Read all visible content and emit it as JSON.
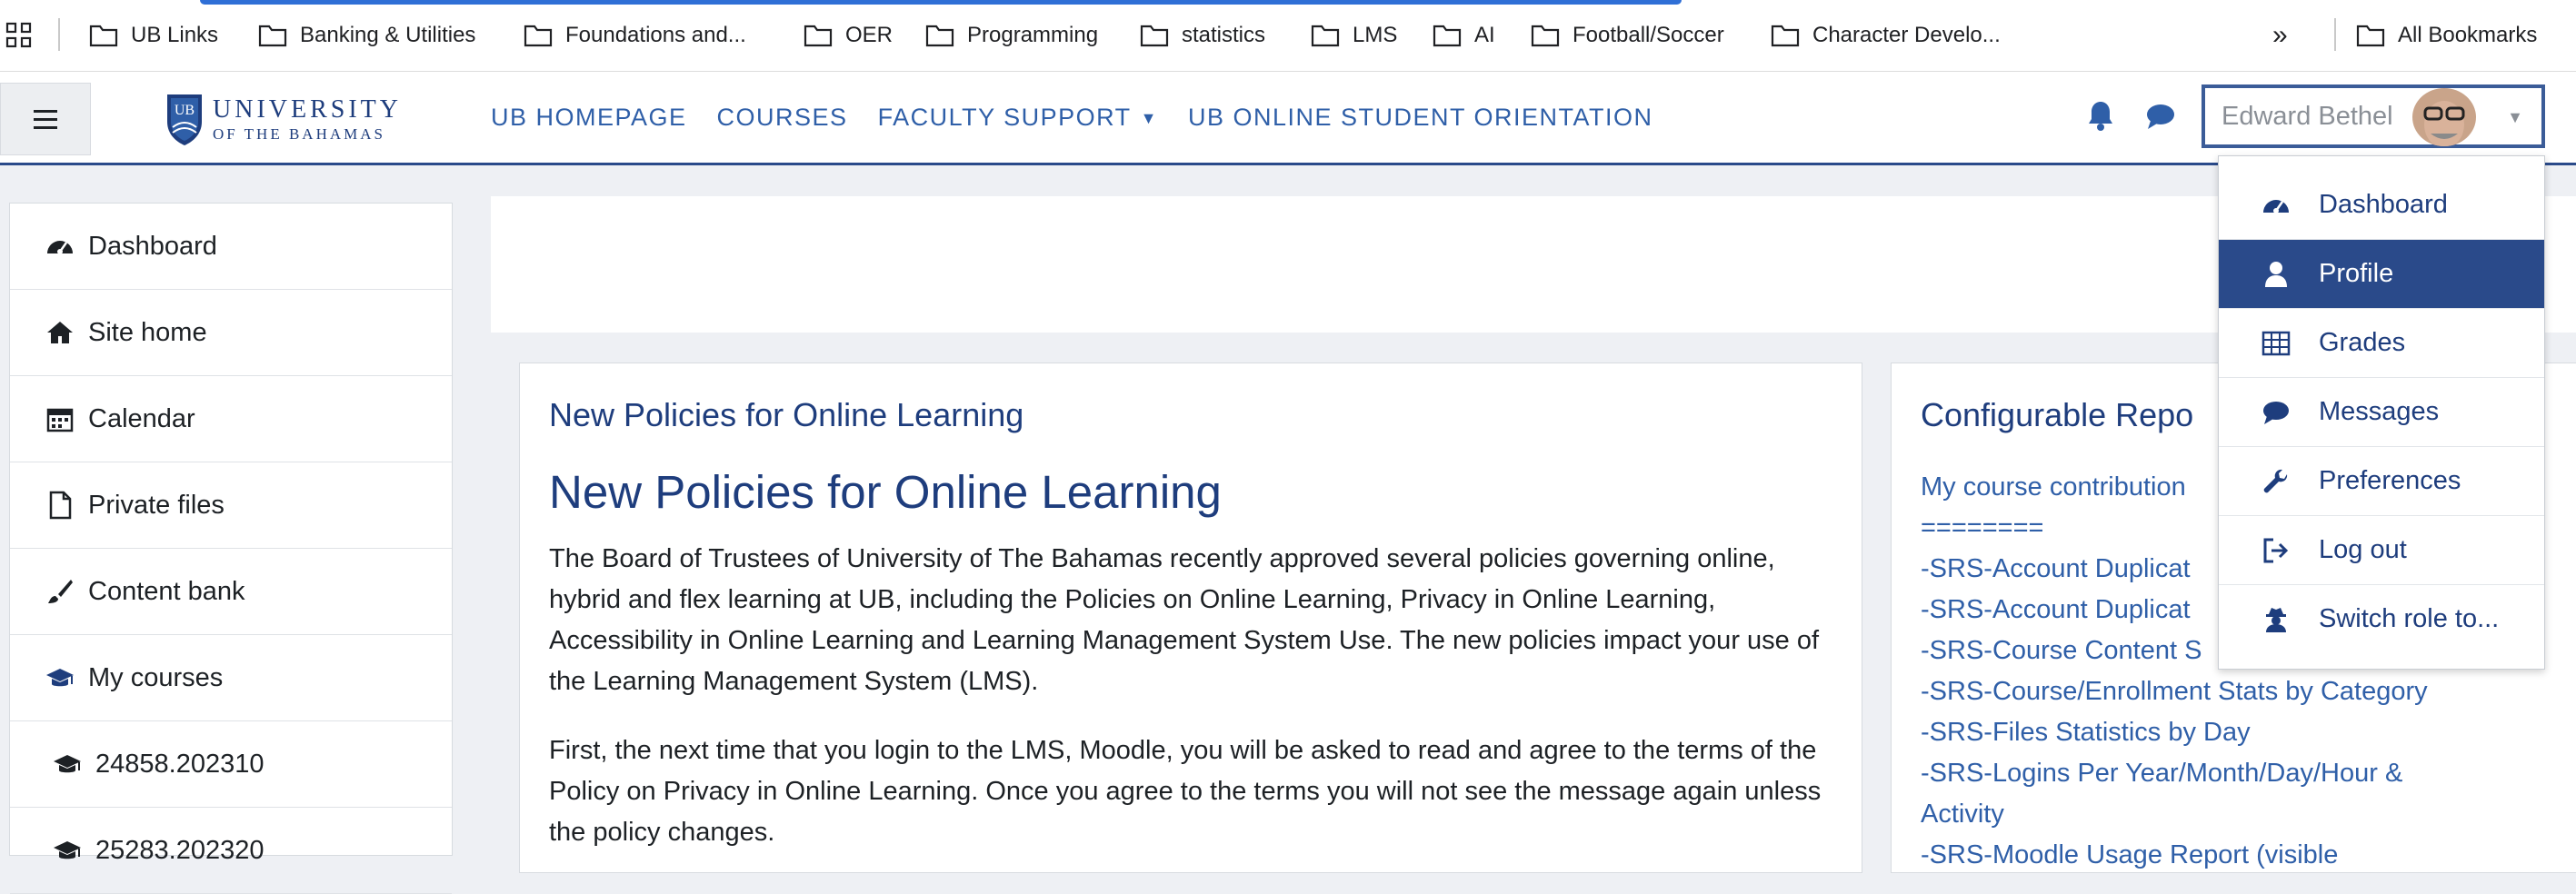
{
  "bookmarks": {
    "items": [
      {
        "label": "UB Links"
      },
      {
        "label": "Banking & Utilities"
      },
      {
        "label": "Foundations and..."
      },
      {
        "label": "OER"
      },
      {
        "label": "Programming"
      },
      {
        "label": "statistics"
      },
      {
        "label": "LMS"
      },
      {
        "label": "AI"
      },
      {
        "label": "Football/Soccer"
      },
      {
        "label": "Character Develo..."
      }
    ],
    "overflow_label": "»",
    "all_label": "All Bookmarks"
  },
  "header": {
    "logo_line1": "UNIVERSITY",
    "logo_line2": "OF THE BAHAMAS",
    "logo_emblem": "UB",
    "nav": [
      {
        "label": "UB HOMEPAGE"
      },
      {
        "label": "COURSES"
      },
      {
        "label": "FACULTY SUPPORT",
        "has_caret": true
      },
      {
        "label": "UB ONLINE STUDENT ORIENTATION"
      }
    ],
    "user_name": "Edward Bethel"
  },
  "drawer": {
    "items": [
      {
        "label": "Dashboard",
        "icon": "dashboard-icon"
      },
      {
        "label": "Site home",
        "icon": "home-icon"
      },
      {
        "label": "Calendar",
        "icon": "calendar-icon"
      },
      {
        "label": "Private files",
        "icon": "file-icon"
      },
      {
        "label": "Content bank",
        "icon": "paintbrush-icon"
      },
      {
        "label": "My courses",
        "icon": "graduation-cap-icon"
      },
      {
        "label": "24858.202310",
        "icon": "graduation-cap-icon"
      },
      {
        "label": "25283.202320",
        "icon": "graduation-cap-icon"
      }
    ]
  },
  "main": {
    "card_title": "New Policies for Online Learning",
    "heading": "New Policies for Online Learning",
    "paragraph1": "The Board of Trustees of University of The Bahamas recently approved several policies governing online, hybrid and flex learning at UB, including the Policies on Online Learning, Privacy in Online Learning, Accessibility in Online Learning and Learning Management System Use. The new policies impact your use of the Learning Management System (LMS).",
    "paragraph2": "First, the next time that you login to the LMS, Moodle, you will be asked to read and agree to the terms of the Policy on Privacy in Online Learning. Once you agree to the terms you will not see the message again unless the policy changes."
  },
  "side": {
    "title": "Configurable Repo",
    "links": [
      "My course contribution",
      "========",
      "-SRS-Account Duplicat",
      "-SRS-Account Duplicat",
      "-SRS-Course Content S",
      "-SRS-Course/Enrollment Stats by Category",
      "-SRS-Files Statistics by Day",
      "-SRS-Logins Per Year/Month/Day/Hour &",
      "Activity",
      "-SRS-Moodle Usage Report (visible"
    ]
  },
  "user_dropdown": {
    "items": [
      {
        "label": "Dashboard",
        "icon": "dashboard-icon"
      },
      {
        "label": "Profile",
        "icon": "user-icon",
        "active": true
      },
      {
        "label": "Grades",
        "icon": "table-icon"
      },
      {
        "label": "Messages",
        "icon": "comment-icon"
      },
      {
        "label": "Preferences",
        "icon": "wrench-icon"
      },
      {
        "label": "Log out",
        "icon": "sign-out-icon"
      },
      {
        "label": "Switch role to...",
        "icon": "user-secret-icon"
      }
    ]
  },
  "colors": {
    "brand": "#1e3d7d",
    "link": "#2f5fa8",
    "active": "#2a4a8a"
  }
}
